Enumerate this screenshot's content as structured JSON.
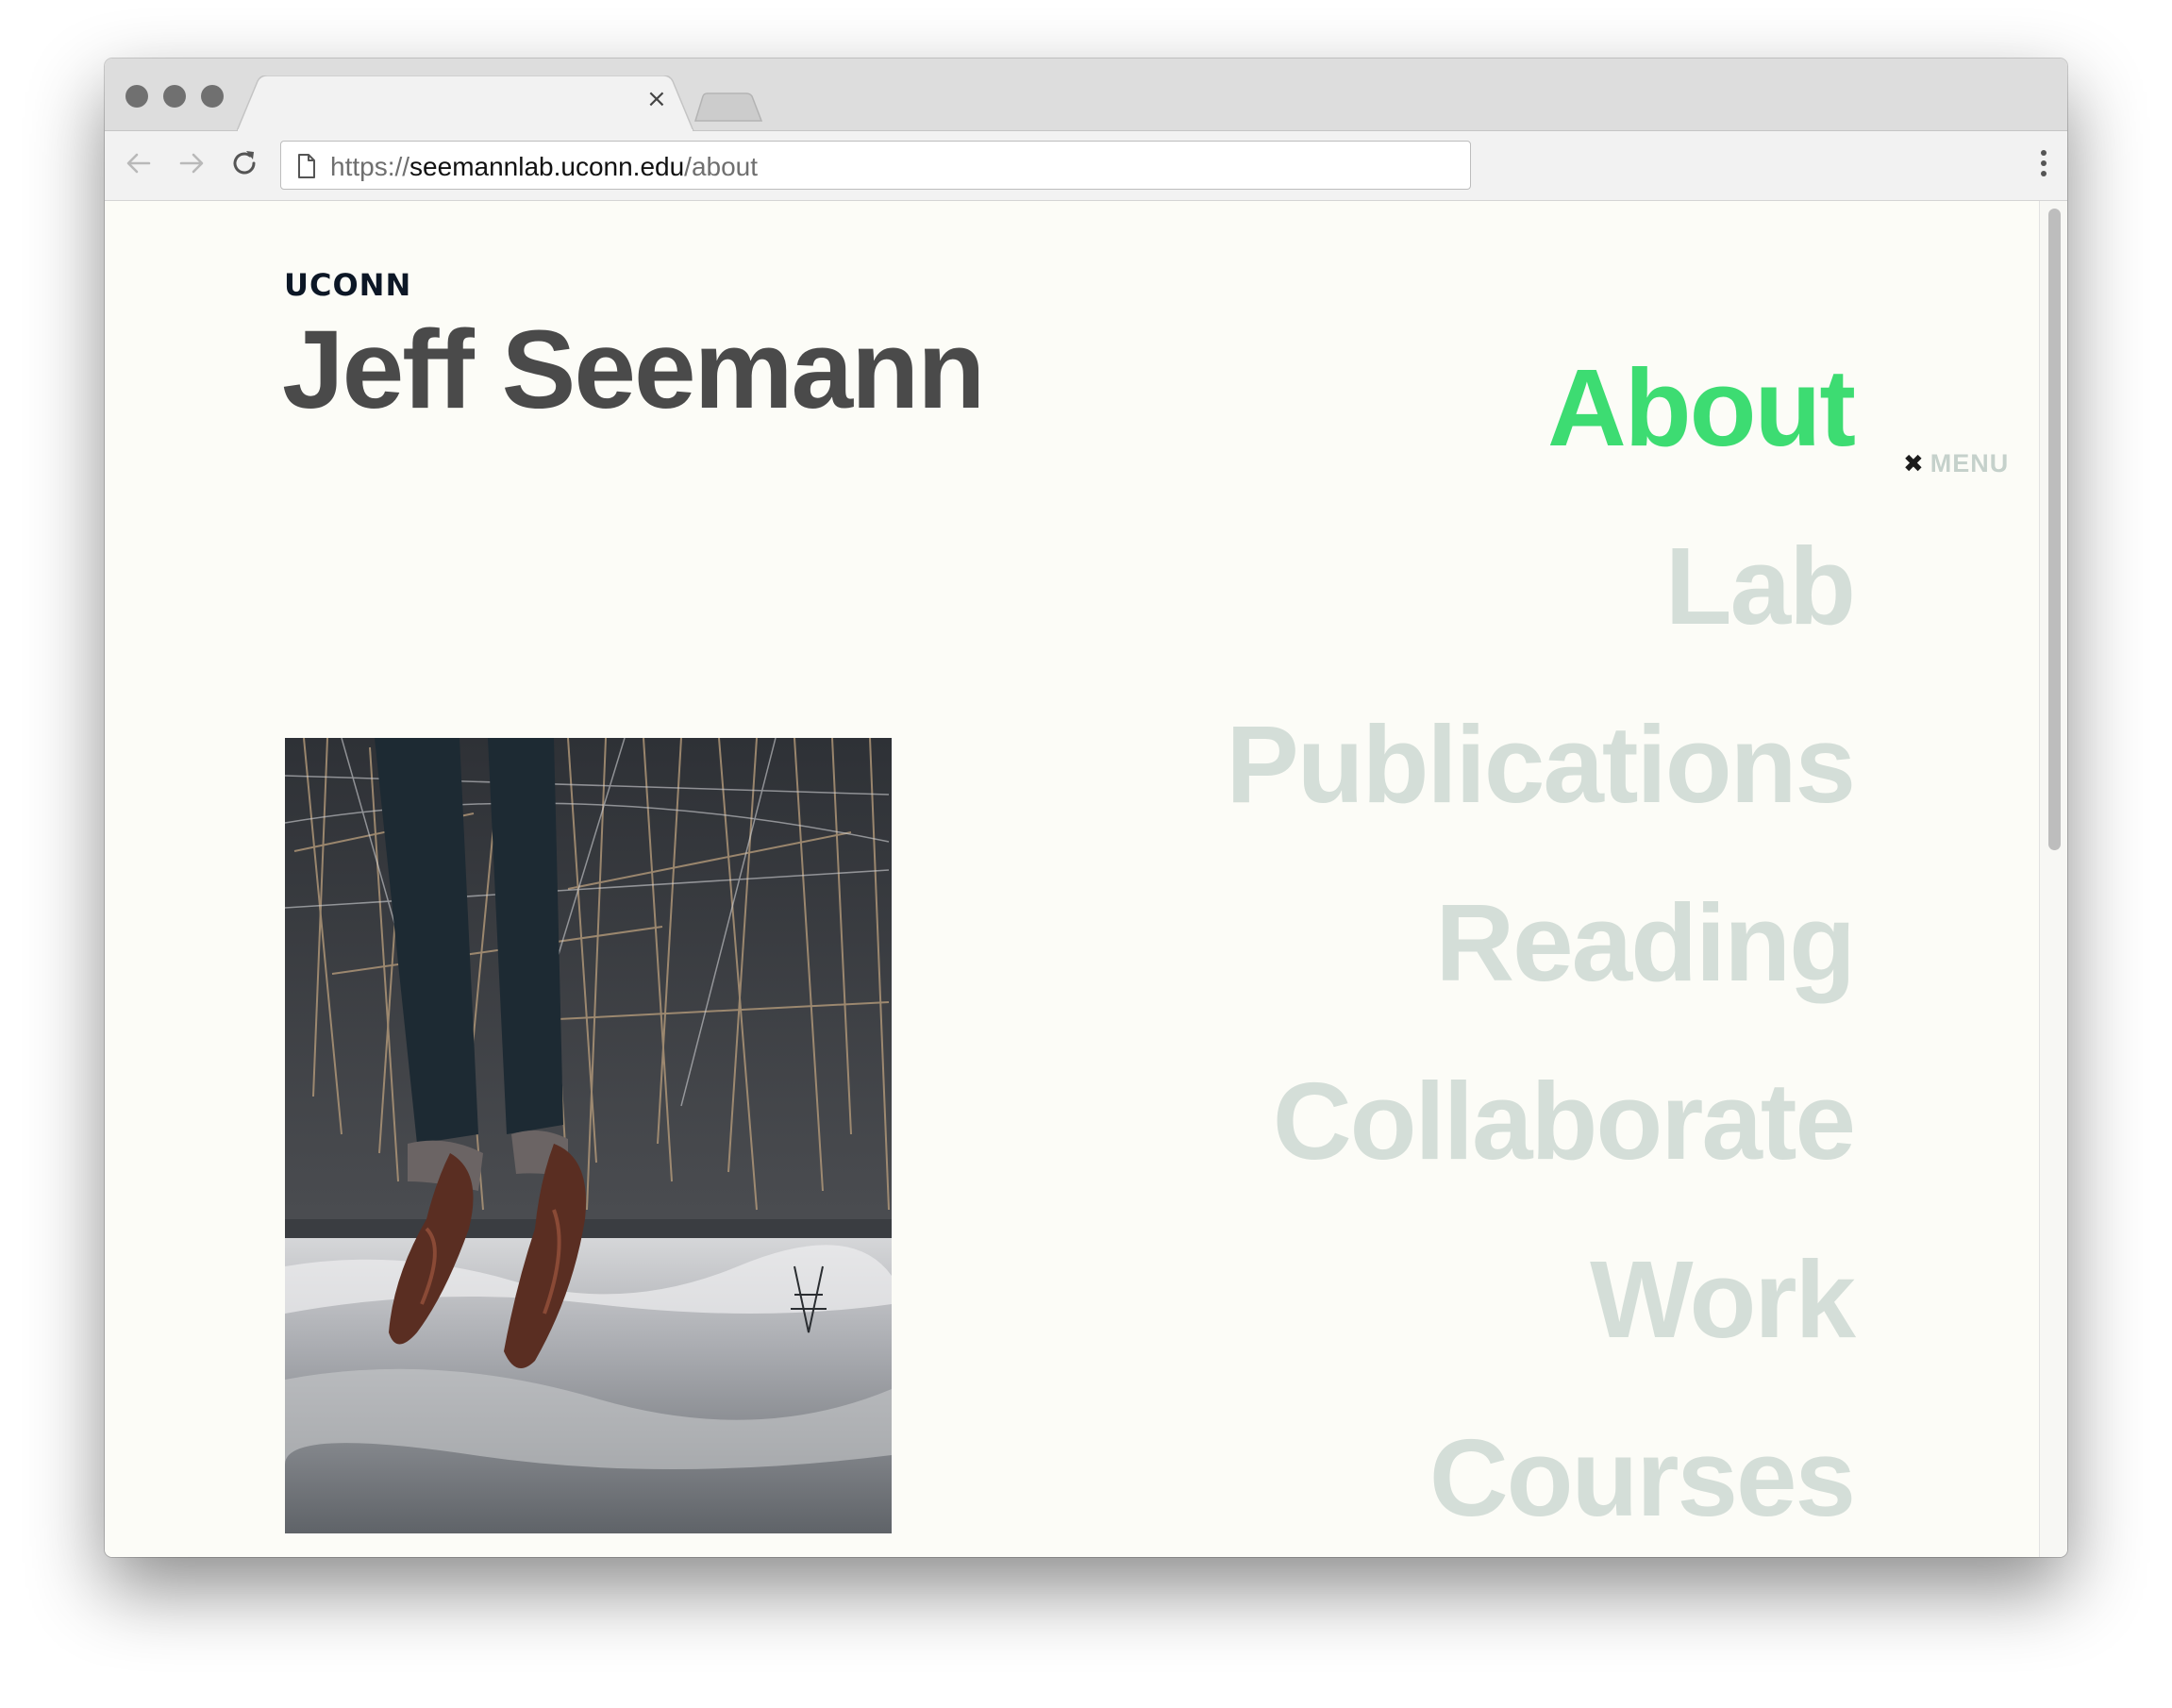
{
  "browser": {
    "tab_close": "×",
    "url_scheme": "https://",
    "url_host": "seemannlab.uconn.edu",
    "url_path": "/about"
  },
  "site": {
    "brand": "UCONN",
    "title": "Jeff Seemann"
  },
  "menu": {
    "close_glyph": "✖",
    "label": "MENU"
  },
  "nav": {
    "items": [
      {
        "label": "About",
        "active": true
      },
      {
        "label": "Lab",
        "active": false
      },
      {
        "label": "Publications",
        "active": false
      },
      {
        "label": "Reading",
        "active": false
      },
      {
        "label": "Collaborate",
        "active": false
      },
      {
        "label": "Work",
        "active": false
      },
      {
        "label": "Courses",
        "active": false
      }
    ]
  },
  "colors": {
    "active_nav": "#3ddc72",
    "inactive_nav": "#d4ded8",
    "title": "#4a4a4a",
    "page_bg": "#fcfcf7"
  },
  "icons": {
    "back": "arrow-left-icon",
    "forward": "arrow-right-icon",
    "reload": "reload-icon",
    "page": "page-icon",
    "more": "kebab-menu-icon"
  }
}
